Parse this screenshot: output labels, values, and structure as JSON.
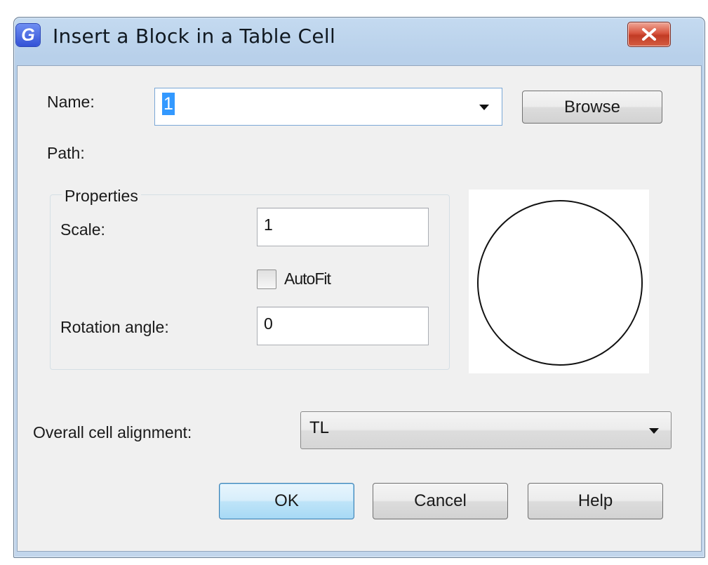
{
  "window": {
    "title": "Insert a Block in a Table Cell",
    "app_icon_letter": "G"
  },
  "name_field": {
    "label": "Name:",
    "value": "1",
    "browse_label": "Browse"
  },
  "path": {
    "label": "Path:"
  },
  "properties": {
    "group_label": "Properties",
    "scale_label": "Scale:",
    "scale_value": "1",
    "autofit_label": "AutoFit",
    "autofit_checked": false,
    "rotation_label": "Rotation angle:",
    "rotation_value": "0"
  },
  "preview": {
    "shape": "circle"
  },
  "alignment": {
    "label": "Overall cell alignment:",
    "value": "TL"
  },
  "buttons": {
    "ok": "OK",
    "cancel": "Cancel",
    "help": "Help"
  },
  "colors": {
    "title_gradient_top": "#c4daf0",
    "close_button_red": "#c23b24",
    "selection_blue": "#3399ff",
    "default_button_blue": "#bee4f8"
  }
}
